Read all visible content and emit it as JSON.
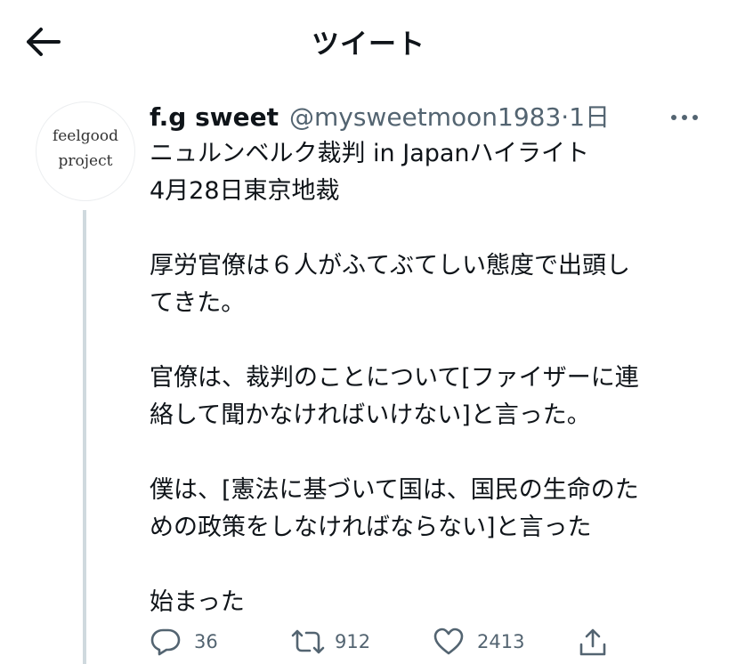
{
  "header": {
    "title": "ツイート",
    "back_icon": "arrow-left-icon"
  },
  "author": {
    "avatar_line1": "feelgood",
    "avatar_line2": "project",
    "display_name": "f.g  sweet",
    "handle": "@mysweetmoon1983",
    "separator": "·",
    "time": "1日"
  },
  "tweet": {
    "lines": [
      "ニュルンベルク裁判 in Japanハイライト",
      "4月28日東京地裁",
      "",
      "厚労官僚は６人がふてぶてしい態度で出頭し",
      "てきた。",
      "",
      "官僚は、裁判のことについて[ファイザーに連",
      "絡して聞かなければいけない]と言った。",
      "",
      "僕は、[憲法に基づいて国は、国民の生命のた",
      "めの政策をしなければならない]と言った",
      "",
      "始まった"
    ]
  },
  "actions": {
    "reply_count": "36",
    "retweet_count": "912",
    "like_count": "2413",
    "icons": [
      "reply-icon",
      "retweet-icon",
      "like-icon",
      "share-icon"
    ]
  },
  "colors": {
    "text": "#0f1419",
    "secondary": "#536471",
    "thread_line": "#cfd9de"
  }
}
